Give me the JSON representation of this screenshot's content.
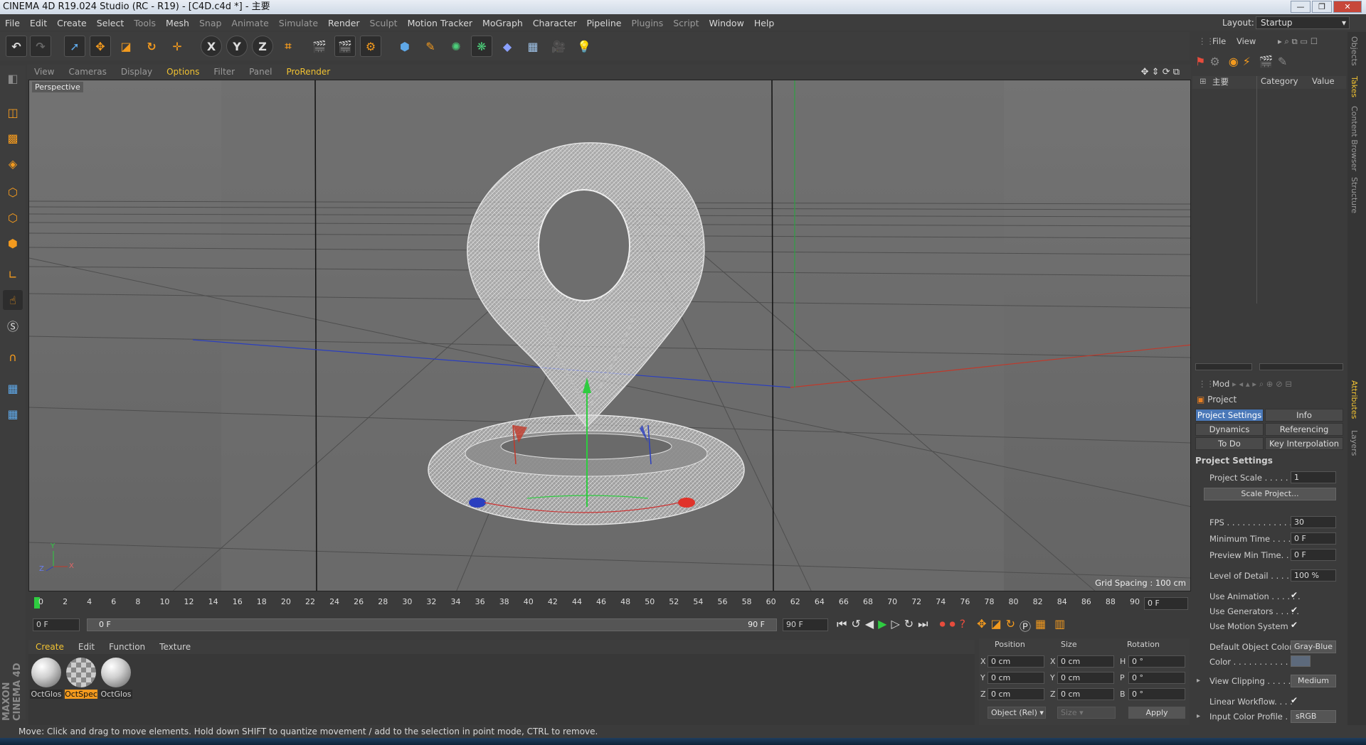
{
  "window": {
    "title": "CINEMA 4D R19.024 Studio (RC - R19) - [C4D.c4d *] - 主要",
    "buttons": [
      "—",
      "❐",
      "✕"
    ]
  },
  "menubar": {
    "items": [
      "File",
      "Edit",
      "Create",
      "Select",
      "Tools",
      "Mesh",
      "Snap",
      "Animate",
      "Simulate",
      "Render",
      "Sculpt",
      "Motion Tracker",
      "MoGraph",
      "Character",
      "Pipeline",
      "Plugins",
      "Script",
      "Window",
      "Help"
    ]
  },
  "layout": {
    "label": "Layout:",
    "value": "Startup"
  },
  "toolbar": {
    "axis_labels": [
      "X",
      "Y",
      "Z"
    ]
  },
  "viewport": {
    "menu": [
      "View",
      "Cameras",
      "Display",
      "Options",
      "Filter",
      "Panel",
      "ProRender"
    ],
    "highlighted": [
      "Options",
      "ProRender"
    ],
    "camera_label": "Perspective",
    "grid_spacing": "Grid Spacing : 100 cm",
    "axis": {
      "y": "Y",
      "z": "Z",
      "x": "X"
    }
  },
  "timeline": {
    "ticks": [
      "0",
      "2",
      "4",
      "6",
      "8",
      "10",
      "12",
      "14",
      "16",
      "18",
      "20",
      "22",
      "24",
      "26",
      "28",
      "30",
      "32",
      "34",
      "36",
      "38",
      "40",
      "42",
      "44",
      "46",
      "48",
      "50",
      "52",
      "54",
      "56",
      "58",
      "60",
      "62",
      "64",
      "66",
      "68",
      "70",
      "72",
      "74",
      "76",
      "78",
      "80",
      "82",
      "84",
      "86",
      "88",
      "90"
    ],
    "current_frame": "0 F"
  },
  "range": {
    "start": "0 F",
    "slider_start": "0 F",
    "slider_end": "90 F",
    "end": "90 F"
  },
  "materials": {
    "menu": [
      "Create",
      "Edit",
      "Function",
      "Texture"
    ],
    "highlighted": "Create",
    "items": [
      {
        "label": "OctGlos",
        "selected": false
      },
      {
        "label": "OctSpec",
        "selected": true
      },
      {
        "label": "OctGlos",
        "selected": false
      }
    ],
    "brand": "MAXON CINEMA 4D"
  },
  "coordinates": {
    "headers": [
      "Position",
      "Size",
      "Rotation"
    ],
    "rows": [
      {
        "pl": "X",
        "pv": "0 cm",
        "sl": "X",
        "sv": "0 cm",
        "rl": "H",
        "rv": "0 °"
      },
      {
        "pl": "Y",
        "pv": "0 cm",
        "sl": "Y",
        "sv": "0 cm",
        "rl": "P",
        "rv": "0 °"
      },
      {
        "pl": "Z",
        "pv": "0 cm",
        "sl": "Z",
        "sv": "0 cm",
        "rl": "B",
        "rv": "0 °"
      }
    ],
    "mode": "Object (Rel)",
    "size_mode": "Size",
    "apply": "Apply"
  },
  "objects_panel": {
    "menu": [
      "File",
      "View"
    ],
    "root_item": "主要",
    "columns": [
      "Category",
      "Value"
    ]
  },
  "attributes": {
    "mode_label": "Mod",
    "object_title": "Project",
    "tabs": [
      "Project Settings",
      "Info",
      "Dynamics",
      "Referencing",
      "To Do",
      "Key Interpolation"
    ],
    "section": "Project Settings",
    "project_scale": {
      "label": "Project Scale . . . . . .",
      "value": "1"
    },
    "scale_button": "Scale Project...",
    "fps": {
      "label": "FPS . . . . . . . . . . . . . .",
      "value": "30"
    },
    "min_time": {
      "label": "Minimum Time . . . . . .",
      "value": "0 F"
    },
    "preview_min": {
      "label": "Preview Min Time. . . .",
      "value": "0 F"
    },
    "lod": {
      "label": "Level of Detail . . . . . .",
      "value": "100 %"
    },
    "use_animation": {
      "label": "Use Animation . . . . . .",
      "value": "✔"
    },
    "use_generators": {
      "label": "Use Generators . . . . .",
      "value": "✔"
    },
    "use_motion": {
      "label": "Use Motion System",
      "value": "✔"
    },
    "default_color": {
      "label": "Default Object Color",
      "value": "Gray-Blue"
    },
    "color": {
      "label": "Color . . . . . . . . . . .",
      "value": ""
    },
    "view_clipping": {
      "label": "View Clipping . . . . . .",
      "value": "Medium"
    },
    "linear_workflow": {
      "label": "Linear Workflow. . . .",
      "value": "✔"
    },
    "input_profile": {
      "label": "Input Color Profile . .",
      "value": "sRGB"
    }
  },
  "side_tabs": [
    "Objects",
    "Takes",
    "Content Browser",
    "Structure",
    "Attributes",
    "Layers"
  ],
  "status": "Move: Click and drag to move elements. Hold down SHIFT to quantize movement / add to the selection in point mode, CTRL to remove."
}
